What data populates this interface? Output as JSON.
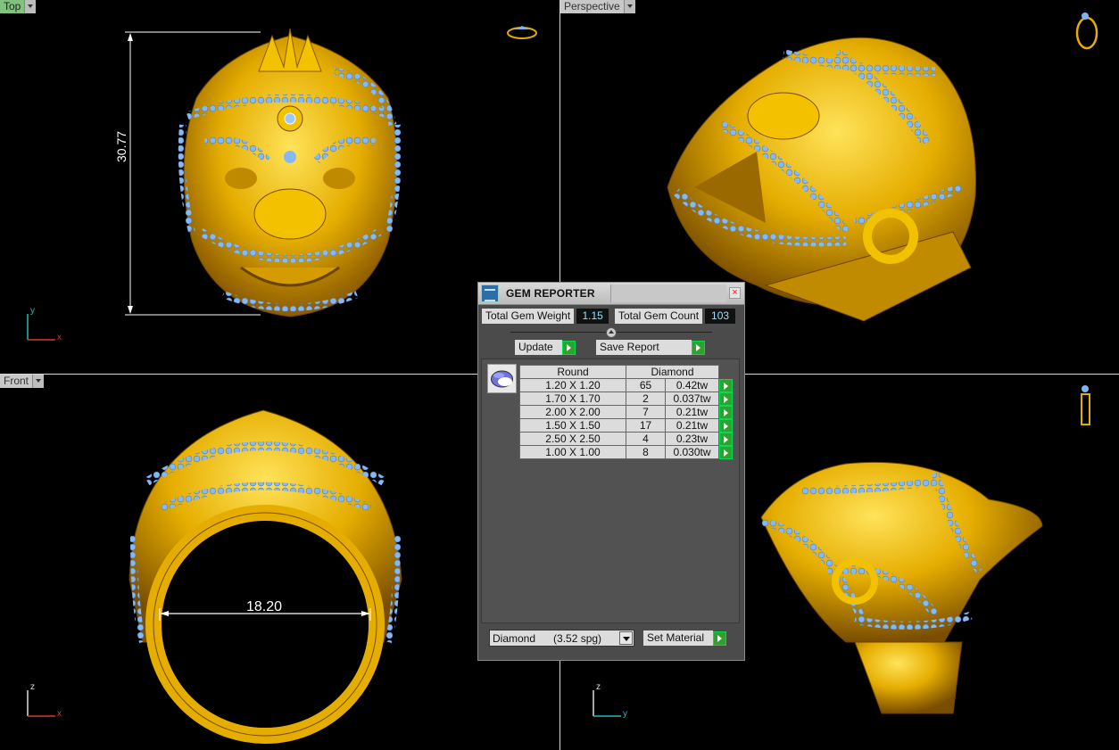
{
  "viewports": {
    "top": {
      "label": "Top",
      "dimension": "30.77",
      "axis_x": "x",
      "axis_y": "y"
    },
    "perspective": {
      "label": "Perspective"
    },
    "front": {
      "label": "Front",
      "dimension": "18.20",
      "axis_x": "x",
      "axis_z": "z"
    },
    "right": {
      "axis_y": "y",
      "axis_z": "z"
    }
  },
  "gem_reporter": {
    "title": "GEM REPORTER",
    "close_glyph": "×",
    "total_gem_weight_label": "Total Gem Weight",
    "total_gem_weight": "1.15",
    "total_gem_count_label": "Total Gem Count",
    "total_gem_count": "103",
    "update_label": "Update",
    "save_report_label": "Save Report",
    "table": {
      "cut_header": "Round",
      "stone_header": "Diamond",
      "rows": [
        {
          "size": "1.20 X 1.20",
          "count": "65",
          "weight": "0.42tw"
        },
        {
          "size": "1.70 X 1.70",
          "count": "2",
          "weight": "0.037tw"
        },
        {
          "size": "2.00 X 2.00",
          "count": "7",
          "weight": "0.21tw"
        },
        {
          "size": "1.50 X 1.50",
          "count": "17",
          "weight": "0.21tw"
        },
        {
          "size": "2.50 X 2.50",
          "count": "4",
          "weight": "0.23tw"
        },
        {
          "size": "1.00 X 1.00",
          "count": "8",
          "weight": "0.030tw"
        }
      ]
    },
    "material_select": "Diamond      (3.52 spg)",
    "set_material_label": "Set Material"
  },
  "colors": {
    "gold": "#e8b000",
    "gem_blue": "#7fb2f0",
    "label_green": "#7fc37f",
    "go_green": "#2ea12e",
    "value_cyan": "#8fe2ff"
  }
}
